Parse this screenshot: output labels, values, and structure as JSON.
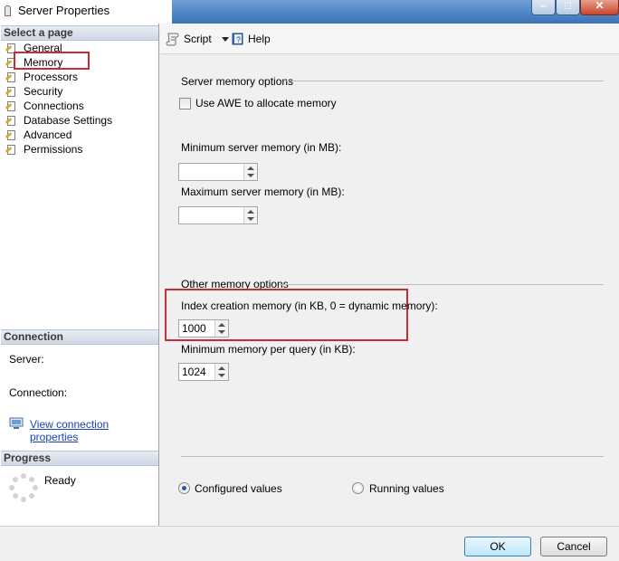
{
  "window": {
    "title": "Server Properties",
    "buttons": {
      "minimize": "–",
      "maximize": "□",
      "close": "✕"
    }
  },
  "left": {
    "select_page_header": "Select a page",
    "pages": [
      {
        "label": "General"
      },
      {
        "label": "Memory",
        "selected": true
      },
      {
        "label": "Processors"
      },
      {
        "label": "Security"
      },
      {
        "label": "Connections"
      },
      {
        "label": "Database Settings"
      },
      {
        "label": "Advanced"
      },
      {
        "label": "Permissions"
      }
    ],
    "connection_header": "Connection",
    "server_label": "Server:",
    "connection_label": "Connection:",
    "view_connection_link": "View connection properties",
    "progress_header": "Progress",
    "progress_status": "Ready"
  },
  "toolbar": {
    "script_label": "Script",
    "help_label": "Help"
  },
  "memory": {
    "server_group_label": "Server memory options",
    "use_awe_label": "Use AWE to allocate memory",
    "use_awe_checked": false,
    "min_server_label": "Minimum server memory (in MB):",
    "min_server_value": "",
    "max_server_label": "Maximum server memory (in MB):",
    "max_server_value": "",
    "other_group_label": "Other memory options",
    "index_creation_label": "Index creation memory (in KB, 0 = dynamic memory):",
    "index_creation_value": "1000",
    "min_per_query_label": "Minimum memory per query (in KB):",
    "min_per_query_value": "1024",
    "configured_values_label": "Configured values",
    "running_values_label": "Running values",
    "selected_view": "Configured values"
  },
  "footer": {
    "ok_label": "OK",
    "cancel_label": "Cancel"
  },
  "colors": {
    "highlight_red": "#cc2a36",
    "link_blue": "#1a3fb8",
    "titlebar_blue": "#4f86c6"
  }
}
